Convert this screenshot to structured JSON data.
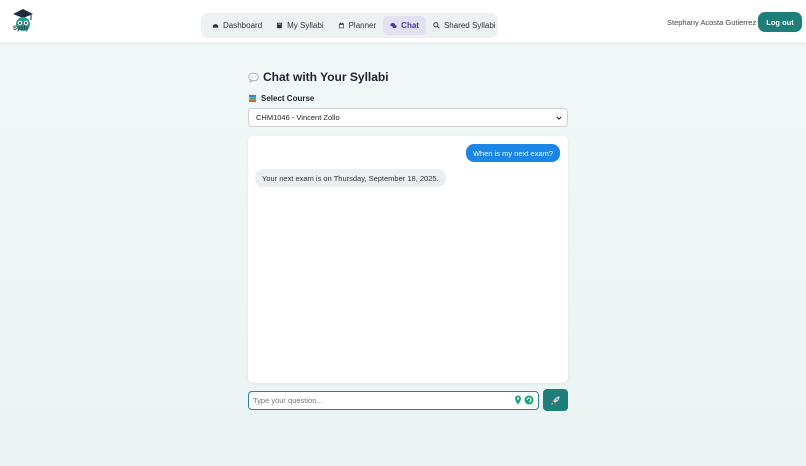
{
  "header": {
    "logo_text": "Syllly",
    "nav": [
      {
        "label": "Dashboard",
        "icon": "dashboard-icon",
        "active": false
      },
      {
        "label": "My Syllabi",
        "icon": "book-icon",
        "active": false
      },
      {
        "label": "Planner",
        "icon": "calendar-icon",
        "active": false
      },
      {
        "label": "Chat",
        "icon": "chat-icon",
        "active": true
      },
      {
        "label": "Shared Syllabi",
        "icon": "search-icon",
        "active": false
      }
    ],
    "user_name": "Stephany Acosta Gutierrez",
    "logout_label": "Log out"
  },
  "main": {
    "title": "Chat with Your Syllabi",
    "title_icon": "speech-bubble-icon",
    "course_label": "Select Course",
    "course_label_icon": "books-icon",
    "selected_course": "CHM1046 - Vincent Zollo"
  },
  "chat": {
    "messages": [
      {
        "role": "user",
        "text": "When is my next exam?"
      },
      {
        "role": "assistant",
        "text": "Your next exam is on Thursday, September 18, 2025."
      }
    ]
  },
  "composer": {
    "placeholder": "Type your question...",
    "send_icon": "rocket-icon"
  },
  "colors": {
    "accent": "#1e7f7a",
    "user_bubble": "#1a86e8",
    "active_nav": "#e4e0f3"
  }
}
